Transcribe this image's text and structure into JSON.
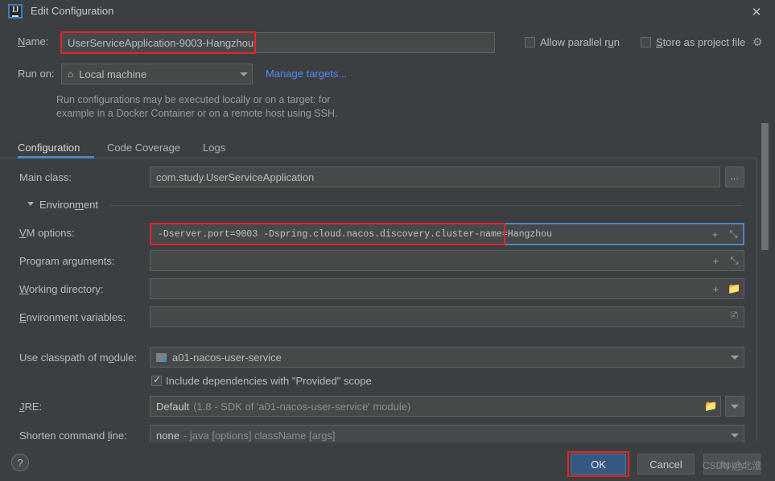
{
  "window": {
    "title": "Edit Configuration",
    "logo_text": "IJ",
    "close_icon": "✕"
  },
  "header": {
    "name_label": "Name:",
    "name_value": "UserServiceApplication-9003-Hangzhou",
    "run_on_label": "Run on:",
    "run_on_value": "Local machine",
    "run_on_icon": "🏠",
    "manage_targets_link": "Manage targets...",
    "allow_parallel_run_label": "Allow parallel run",
    "allow_parallel_run_checked": false,
    "store_as_project_file_label": "Store as project file",
    "store_as_project_file_checked": false,
    "gear_icon": "⚙",
    "description_line1": "Run configurations may be executed locally or on a target: for",
    "description_line2": "example in a Docker Container or on a remote host using SSH."
  },
  "tabs": [
    {
      "label": "Configuration",
      "active": true
    },
    {
      "label": "Code Coverage",
      "active": false
    },
    {
      "label": "Logs",
      "active": false
    }
  ],
  "form": {
    "main_class": {
      "label": "Main class:",
      "value": "com.study.UserServiceApplication",
      "browse_button": "…"
    },
    "environment_section": {
      "label": "Environment",
      "expanded": true
    },
    "vm_options": {
      "label": "VM options:",
      "label_mnemonic": "V",
      "value": "-Dserver.port=9003 -Dspring.cloud.nacos.discovery.cluster-name=Hangzhou",
      "focused": true,
      "highlighted": true,
      "icons": [
        "plus-icon",
        "expand-icon"
      ]
    },
    "program_arguments": {
      "label": "Program arguments:",
      "value": "",
      "icons": [
        "plus-icon",
        "expand-icon"
      ]
    },
    "working_directory": {
      "label": "Working directory:",
      "value": "",
      "icons": [
        "plus-icon",
        "folder-icon"
      ]
    },
    "environment_variables": {
      "label": "Environment variables:",
      "value": "",
      "icons": [
        "list-icon"
      ]
    },
    "use_classpath_of_module": {
      "label": "Use classpath of module:",
      "value": "a01-nacos-user-service",
      "module_icon": "module-icon"
    },
    "include_dependencies": {
      "label": "Include dependencies with \"Provided\" scope",
      "checked": true
    },
    "jre": {
      "label": "JRE:",
      "value": "Default",
      "hint": "(1.8 - SDK of 'a01-nacos-user-service' module)",
      "icons": [
        "folder-icon",
        "chevron-down-icon"
      ]
    },
    "shorten_command_line": {
      "label": "Shorten command line:",
      "value": "none",
      "hint": "- java [options] className [args]",
      "icons": [
        "chevron-down-icon"
      ]
    }
  },
  "footer": {
    "help_label": "?",
    "ok_label": "OK",
    "cancel_label": "Cancel",
    "apply_label": "Apply",
    "ok_highlighted": true,
    "apply_enabled": false
  },
  "watermark": "CSDN @北淮",
  "colors": {
    "dialog_bg": "#3c3f41",
    "field_bg": "#45494a",
    "accent_blue": "#4a88c7",
    "link_blue": "#548af7",
    "highlight_red": "#e8232a",
    "primary_button": "#365880"
  }
}
